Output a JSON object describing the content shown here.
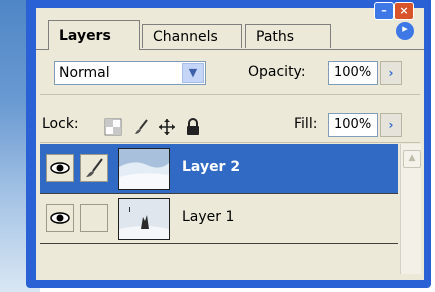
{
  "tabs": [
    {
      "label": "Layers",
      "active": true
    },
    {
      "label": "Channels",
      "active": false
    },
    {
      "label": "Paths",
      "active": false
    }
  ],
  "blend_mode": {
    "selected": "Normal"
  },
  "opacity": {
    "label": "Opacity:",
    "value": "100%"
  },
  "lock": {
    "label": "Lock:",
    "icons": [
      "transparency-lock-icon",
      "brush-lock-icon",
      "move-lock-icon",
      "padlock-icon"
    ]
  },
  "fill": {
    "label": "Fill:",
    "value": "100%"
  },
  "layers": [
    {
      "name": "Layer 2",
      "selected": true,
      "visible": true,
      "brush_linked": true
    },
    {
      "name": "Layer 1",
      "selected": false,
      "visible": true,
      "brush_linked": false
    }
  ],
  "colors": {
    "accent": "#316ac5",
    "frame": "#2a62d6",
    "panel": "#ece9d8"
  }
}
